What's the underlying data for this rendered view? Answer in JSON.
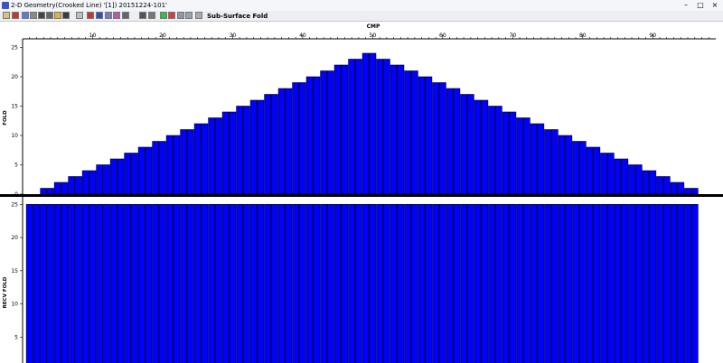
{
  "window": {
    "title": "2-D Geometry(Crooked Line) '[1]) 20151224-101'",
    "controls": {
      "minimize": "–",
      "maximize": "□",
      "close": "×"
    }
  },
  "toolbar": {
    "buttons": [
      {
        "name": "new-file-icon",
        "color": "#d8c27a"
      },
      {
        "name": "open-file-icon",
        "color": "#c0392b"
      },
      {
        "name": "flag-icon",
        "color": "#5a7bd6"
      },
      {
        "name": "grid-icon",
        "color": "#8a8a8a"
      },
      {
        "name": "pencil-icon",
        "color": "#444444"
      },
      {
        "name": "stack-icon",
        "color": "#666666"
      },
      {
        "name": "folder-icon",
        "color": "#e0b040"
      },
      {
        "name": "save-icon",
        "color": "#3b3b3b"
      },
      {
        "name": "source-icon",
        "color": "#bdbdbd"
      },
      {
        "name": "map-icon",
        "color": "#c0392b"
      },
      {
        "name": "receiver-icon",
        "color": "#2d4fb8"
      },
      {
        "name": "layout-icon",
        "color": "#7a7ab5"
      },
      {
        "name": "palette-icon",
        "color": "#b45ab4"
      },
      {
        "name": "wand-icon",
        "color": "#666666"
      },
      {
        "name": "table-icon",
        "color": "#555555"
      },
      {
        "name": "chart-icon",
        "color": "#777777"
      },
      {
        "name": "green-box-icon",
        "color": "#2fbf4a"
      },
      {
        "name": "red-line-icon",
        "color": "#d04040"
      },
      {
        "name": "reverse-icon",
        "color": "#8899aa"
      },
      {
        "name": "window-icon",
        "color": "#9aa3ad"
      },
      {
        "name": "pointer-icon",
        "color": "#aaaaaa"
      }
    ],
    "label": "Sub-Surface Fold"
  },
  "chart_data": [
    {
      "type": "bar",
      "xlabel": "CMP",
      "ylabel": "FOLD",
      "xlim": [
        0,
        99
      ],
      "ylim": [
        0,
        26
      ],
      "xticks": [
        10,
        20,
        30,
        40,
        50,
        60,
        70,
        80,
        90
      ],
      "yticks": [
        0,
        5,
        10,
        15,
        20,
        25
      ],
      "bar_color": "#0000ff",
      "grid": false,
      "x": [
        1,
        2,
        3,
        4,
        5,
        6,
        7,
        8,
        9,
        10,
        11,
        12,
        13,
        14,
        15,
        16,
        17,
        18,
        19,
        20,
        21,
        22,
        23,
        24,
        25,
        26,
        27,
        28,
        29,
        30,
        31,
        32,
        33,
        34,
        35,
        36,
        37,
        38,
        39,
        40,
        41,
        42,
        43,
        44,
        45,
        46,
        47,
        48,
        49,
        50,
        51,
        52,
        53,
        54,
        55,
        56,
        57,
        58,
        59,
        60,
        61,
        62,
        63,
        64,
        65,
        66,
        67,
        68,
        69,
        70,
        71,
        72,
        73,
        74,
        75,
        76,
        77,
        78,
        79,
        80,
        81,
        82,
        83,
        84,
        85,
        86,
        87,
        88,
        89,
        90,
        91,
        92,
        93,
        94,
        95,
        96,
        97
      ],
      "values": [
        0,
        0,
        1,
        1,
        2,
        2,
        3,
        3,
        4,
        4,
        5,
        5,
        6,
        6,
        7,
        7,
        8,
        8,
        9,
        9,
        10,
        10,
        11,
        11,
        12,
        12,
        13,
        13,
        14,
        14,
        15,
        15,
        16,
        16,
        17,
        17,
        18,
        18,
        19,
        19,
        20,
        20,
        21,
        21,
        22,
        22,
        23,
        23,
        24,
        24,
        23,
        23,
        22,
        22,
        21,
        21,
        20,
        20,
        19,
        19,
        18,
        18,
        17,
        17,
        16,
        16,
        15,
        15,
        14,
        14,
        13,
        13,
        12,
        12,
        11,
        11,
        10,
        10,
        9,
        9,
        8,
        8,
        7,
        7,
        6,
        6,
        5,
        5,
        4,
        4,
        3,
        3,
        2,
        2,
        1,
        1,
        0
      ]
    },
    {
      "type": "bar",
      "ylabel": "RECV FOLD",
      "xlim": [
        0,
        99
      ],
      "ylim": [
        0,
        26
      ],
      "yticks": [
        5,
        10,
        15,
        20,
        25
      ],
      "bar_color": "#0000ff",
      "grid": false,
      "x": [
        1,
        2,
        3,
        4,
        5,
        6,
        7,
        8,
        9,
        10,
        11,
        12,
        13,
        14,
        15,
        16,
        17,
        18,
        19,
        20,
        21,
        22,
        23,
        24,
        25,
        26,
        27,
        28,
        29,
        30,
        31,
        32,
        33,
        34,
        35,
        36,
        37,
        38,
        39,
        40,
        41,
        42,
        43,
        44,
        45,
        46,
        47,
        48,
        49,
        50,
        51,
        52,
        53,
        54,
        55,
        56,
        57,
        58,
        59,
        60,
        61,
        62,
        63,
        64,
        65,
        66,
        67,
        68,
        69,
        70,
        71,
        72,
        73,
        74,
        75,
        76,
        77,
        78,
        79,
        80,
        81,
        82,
        83,
        84,
        85,
        86,
        87,
        88,
        89,
        90,
        91,
        92,
        93,
        94,
        95,
        96
      ],
      "values": [
        25,
        25,
        25,
        25,
        25,
        25,
        25,
        25,
        25,
        25,
        25,
        25,
        25,
        25,
        25,
        25,
        25,
        25,
        25,
        25,
        25,
        25,
        25,
        25,
        25,
        25,
        25,
        25,
        25,
        25,
        25,
        25,
        25,
        25,
        25,
        25,
        25,
        25,
        25,
        25,
        25,
        25,
        25,
        25,
        25,
        25,
        25,
        25,
        25,
        25,
        25,
        25,
        25,
        25,
        25,
        25,
        25,
        25,
        25,
        25,
        25,
        25,
        25,
        25,
        25,
        25,
        25,
        25,
        25,
        25,
        25,
        25,
        25,
        25,
        25,
        25,
        25,
        25,
        25,
        25,
        25,
        25,
        25,
        25,
        25,
        25,
        25,
        25,
        25,
        25,
        25,
        25,
        25,
        25,
        25,
        25
      ]
    }
  ]
}
